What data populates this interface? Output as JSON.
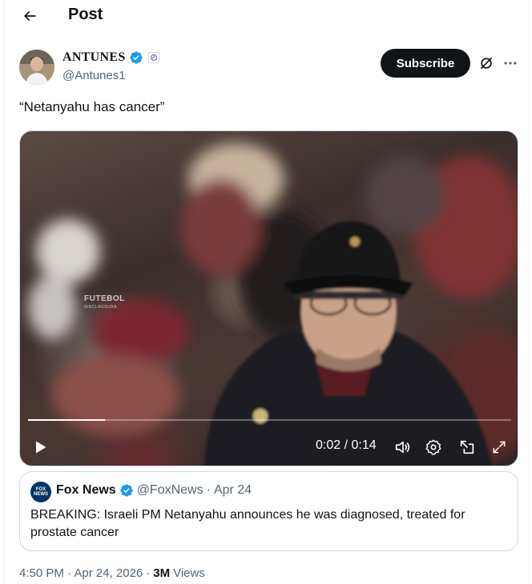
{
  "header": {
    "title": "Post",
    "back_icon": "arrow-left-icon"
  },
  "author": {
    "name": "ANTUNES",
    "handle": "@Antunes1",
    "verified_icon": "verified-badge-icon",
    "affiliate_icon": "affiliate-badge-icon",
    "subscribe_label": "Subscribe",
    "grok_icon": "grok-icon",
    "more_icon": "more-icon"
  },
  "tweet": {
    "text": "“Netanyahu has cancer”"
  },
  "video": {
    "watermark": "FUTEBOL",
    "watermark_sub": "SINCLAUSURA",
    "time": "0:02 / 0:14",
    "progress": 0.16,
    "controls": [
      "play-icon",
      "volume-icon",
      "settings-icon",
      "dock-icon",
      "fullscreen-icon"
    ]
  },
  "quote": {
    "name": "Fox News",
    "handle": "@FoxNews",
    "separator": "·",
    "date": "Apr 24",
    "avatar_text": "FOX NEWS",
    "text": "BREAKING: Israeli PM Netanyahu announces he was diagnosed, treated for prostate cancer"
  },
  "meta": {
    "timestamp": "4:50 PM · Apr 24, 2026",
    "separator": "·",
    "views_count": "3M",
    "views_label": "Views"
  },
  "colors": {
    "accent": "#1d9bf0",
    "text": "#0f1419",
    "muted": "#536471",
    "border": "#cfd9de"
  }
}
